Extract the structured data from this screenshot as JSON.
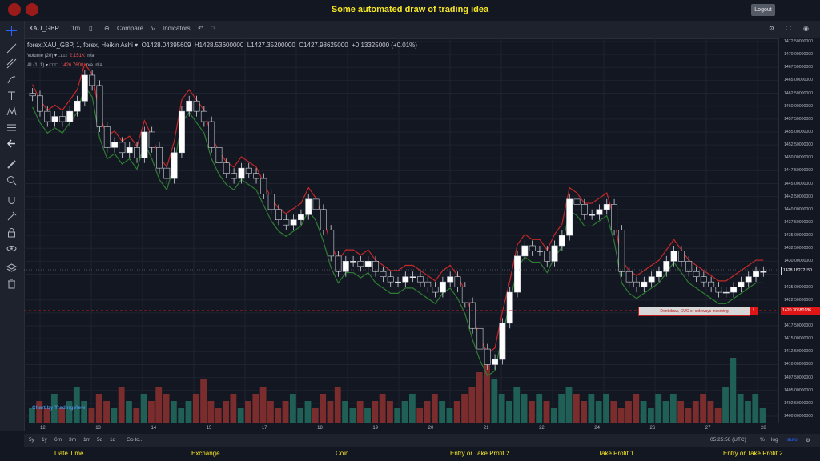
{
  "header": {
    "title": "Some automated draw of trading idea",
    "logout_label": "Logout"
  },
  "toolbar": {
    "symbol": "XAU_GBP",
    "interval": "1m",
    "compare_label": "Compare",
    "indicators_label": "Indicators"
  },
  "legend": {
    "main": "forex:XAU_GBP, 1, forex, Heikin Ashi",
    "open": "O1428.04395609",
    "high": "H1428.53600000",
    "low": "L1427.35200000",
    "close": "C1427.98625000",
    "change": "+0.13325000 (+0.01%)",
    "volume_label": "Volume (20)",
    "volume_value": "2.151K",
    "volume_na": "n/a",
    "ai_label": "AI (1, 1)",
    "ai_value": "1426.7600",
    "ai_na1": "n/a",
    "ai_na2": "n/a"
  },
  "price_scale": [
    "1472.50000000",
    "1470.00000000",
    "1467.50000000",
    "1465.00000000",
    "1462.50000000",
    "1460.00000000",
    "1457.50000000",
    "1455.00000000",
    "1452.50000000",
    "1450.00000000",
    "1447.50000000",
    "1445.00000000",
    "1442.50000000",
    "1440.00000000",
    "1437.50000000",
    "1435.00000000",
    "1432.50000000",
    "1430.00000000",
    "1427.50000000",
    "1425.00000000",
    "1422.50000000",
    "1420.00000000",
    "1417.50000000",
    "1415.00000000",
    "1412.50000000",
    "1410.00000000",
    "1407.50000000",
    "1405.00000000",
    "1402.50000000",
    "1400.00000000"
  ],
  "current_price": "1428.18272150",
  "line_price": "1420.30680186",
  "annotation": {
    "text": "Dont draw, CUC or sideways incoming",
    "flag": "!"
  },
  "x_labels": [
    "12",
    "13",
    "14",
    "15",
    "17",
    "18",
    "19",
    "20",
    "21",
    "22",
    "24",
    "26",
    "27",
    "28"
  ],
  "bottom": {
    "ranges": [
      "5y",
      "1y",
      "6m",
      "3m",
      "1m",
      "5d",
      "1d"
    ],
    "goto": "Go to...",
    "time": "05:25:56 (UTC)",
    "pct": "%",
    "log": "log",
    "auto": "auto"
  },
  "watermark": "Chart by TradingView",
  "footer": [
    "Date Time",
    "Exchange",
    "Coin",
    "Entry or Take Profit 2",
    "Take Profit 1",
    "Entry or Take Profit 2"
  ],
  "colors": {
    "up": "#26a69a",
    "down": "#ef5350",
    "upper_line": "#c62828",
    "lower_line": "#2e7d32",
    "accent": "#f5e625"
  },
  "chart_data": {
    "type": "candlestick",
    "style": "Heikin Ashi",
    "series_close": [
      1462,
      1459,
      1457,
      1458,
      1457,
      1459,
      1461,
      1466,
      1464,
      1456,
      1452,
      1453,
      1451,
      1452,
      1450,
      1455,
      1452,
      1448,
      1446,
      1451,
      1459,
      1461,
      1459,
      1457,
      1452,
      1449,
      1447,
      1446,
      1448,
      1447,
      1446,
      1443,
      1440,
      1438,
      1437,
      1438,
      1439,
      1442,
      1440,
      1436,
      1431,
      1428,
      1430,
      1430,
      1429,
      1430,
      1428,
      1427,
      1426,
      1426,
      1427,
      1427,
      1426,
      1425,
      1424,
      1426,
      1427,
      1425,
      1422,
      1417,
      1413,
      1410,
      1411,
      1418,
      1424,
      1431,
      1433,
      1432,
      1432,
      1430,
      1433,
      1435,
      1442,
      1441,
      1439,
      1439,
      1440,
      1441,
      1436,
      1428,
      1426,
      1425,
      1426,
      1427,
      1428,
      1430,
      1432,
      1430,
      1428,
      1427,
      1426,
      1425,
      1424,
      1424,
      1425,
      1426,
      1427,
      1428,
      1428
    ],
    "volume": [
      2,
      3,
      2,
      4,
      2,
      3,
      5,
      3,
      2,
      4,
      3,
      2,
      5,
      3,
      2,
      4,
      3,
      5,
      4,
      3,
      2,
      3,
      4,
      6,
      3,
      2,
      3,
      4,
      2,
      3,
      4,
      5,
      3,
      2,
      3,
      4,
      2,
      3,
      2,
      4,
      3,
      5,
      3,
      2,
      3,
      2,
      3,
      4,
      3,
      2,
      3,
      4,
      2,
      3,
      4,
      3,
      2,
      3,
      4,
      5,
      7,
      9,
      6,
      4,
      3,
      5,
      4,
      3,
      4,
      3,
      2,
      4,
      5,
      4,
      3,
      4,
      3,
      4,
      3,
      2,
      3,
      4,
      3,
      2,
      4,
      3,
      4,
      3,
      2,
      3,
      4,
      3,
      2,
      5,
      9,
      4,
      3,
      4,
      2
    ]
  }
}
